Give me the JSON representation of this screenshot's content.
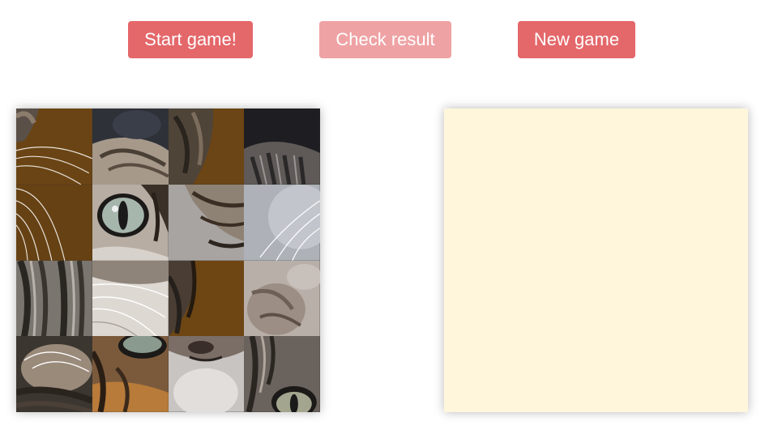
{
  "controls": {
    "start_label": "Start game!",
    "check_label": "Check result",
    "new_label": "New game"
  },
  "colors": {
    "button": "#e4676a",
    "button_disabled": "#efa2a4",
    "drop_area": "#fff6dc"
  },
  "puzzle": {
    "grid": [
      4,
      4
    ],
    "image_subject": "tabby kitten face",
    "tiles": [
      {
        "name": "tile-whiskers-brown"
      },
      {
        "name": "tile-fur-top"
      },
      {
        "name": "tile-ear-brown"
      },
      {
        "name": "tile-dark-fur"
      },
      {
        "name": "tile-whiskers-long"
      },
      {
        "name": "tile-eye-left"
      },
      {
        "name": "tile-cheek-gray"
      },
      {
        "name": "tile-whiskers-gray"
      },
      {
        "name": "tile-stripes"
      },
      {
        "name": "tile-muzzle-white"
      },
      {
        "name": "tile-ear-edge"
      },
      {
        "name": "tile-fur-light"
      },
      {
        "name": "tile-chin-fur"
      },
      {
        "name": "tile-eye-right-half"
      },
      {
        "name": "tile-nose"
      },
      {
        "name": "tile-eye-bottom"
      }
    ]
  }
}
